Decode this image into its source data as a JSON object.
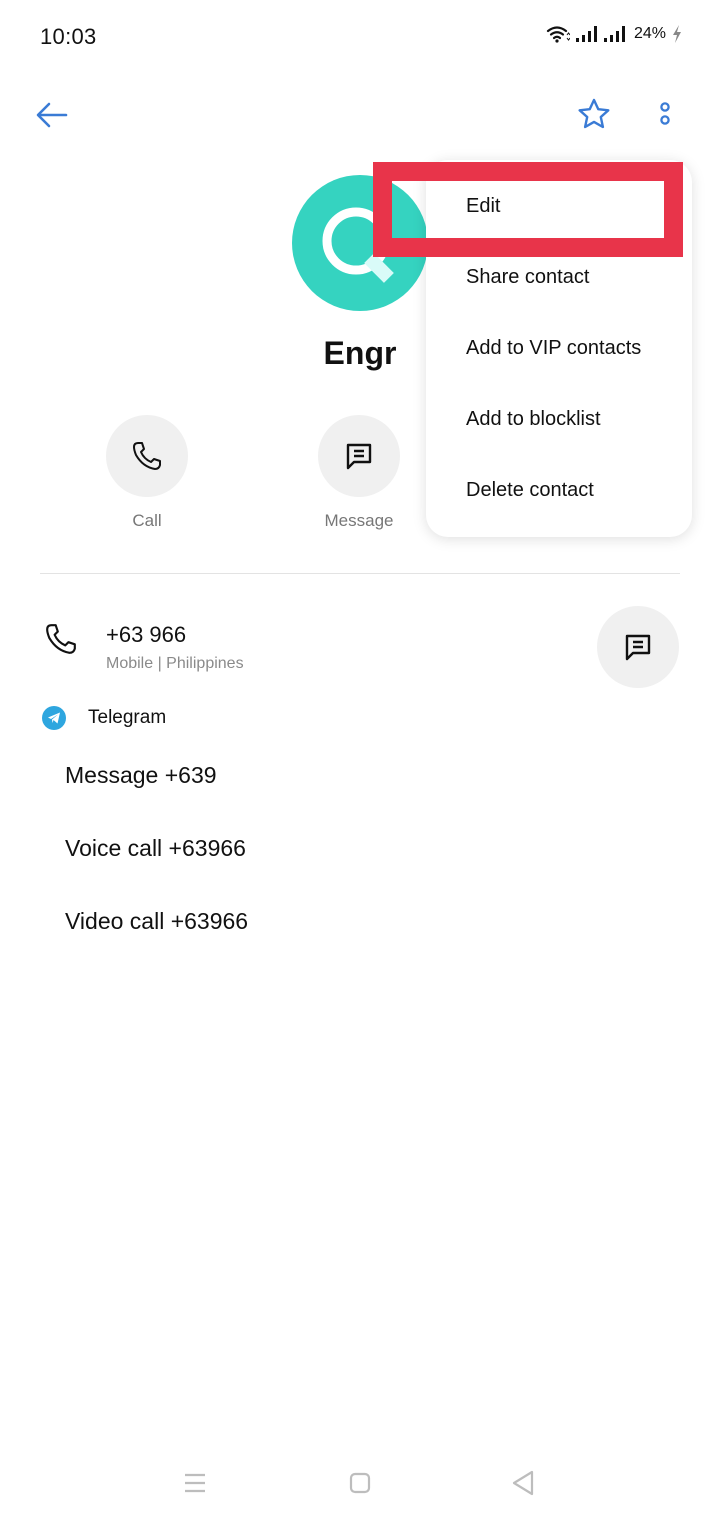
{
  "status_bar": {
    "time": "10:03",
    "battery": "24%",
    "icons": [
      "wifi-icon",
      "signal-icon",
      "signal-icon",
      "charging-icon"
    ]
  },
  "top_bar": {
    "back_icon": "arrow-left-icon",
    "favorite_icon": "star-outline-icon",
    "more_icon": "more-vertical-icon",
    "accent_color": "#3a7bd5"
  },
  "contact": {
    "avatar_letter": "Q",
    "avatar_color": "#35d3c0",
    "name": "Engr"
  },
  "quick_actions": [
    {
      "label": "Call",
      "icon": "phone-icon"
    },
    {
      "label": "Message",
      "icon": "message-icon"
    }
  ],
  "phone": {
    "number": "+63 966",
    "meta": "Mobile | Philippines",
    "action_icon": "message-icon"
  },
  "telegram": {
    "label": "Telegram",
    "icon": "telegram-icon",
    "color": "#2ea6df",
    "actions": [
      {
        "label": "Message +639"
      },
      {
        "label": "Voice call +63966"
      },
      {
        "label": "Video call +63966"
      }
    ]
  },
  "menu": {
    "items": [
      {
        "label": "Edit"
      },
      {
        "label": "Share contact"
      },
      {
        "label": "Add to VIP contacts"
      },
      {
        "label": "Add to blocklist"
      },
      {
        "label": "Delete contact"
      }
    ],
    "highlighted_index": 0,
    "highlight_color": "#e8344a"
  },
  "nav_bar": {
    "icons": [
      "recent-apps-icon",
      "home-icon",
      "back-triangle-icon"
    ]
  }
}
